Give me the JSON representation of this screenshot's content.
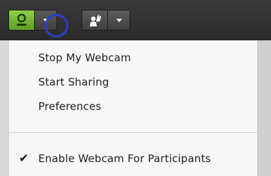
{
  "toolbar": {
    "webcam_button_icon": "webcam-person-icon",
    "webcam_dropdown_icon": "chevron-down-icon",
    "raise_hand_icon": "raise-hand-icon",
    "raise_hand_dropdown_icon": "chevron-down-icon",
    "active_color": "#6fb434",
    "highlight_ring_color": "#2f3ccf"
  },
  "menu": {
    "items": [
      {
        "label": "Stop My Webcam"
      },
      {
        "label": "Start Sharing"
      },
      {
        "label": "Preferences"
      }
    ],
    "toggle": {
      "label": "Enable Webcam For Participants",
      "checked": true,
      "check_glyph": "✔"
    }
  }
}
